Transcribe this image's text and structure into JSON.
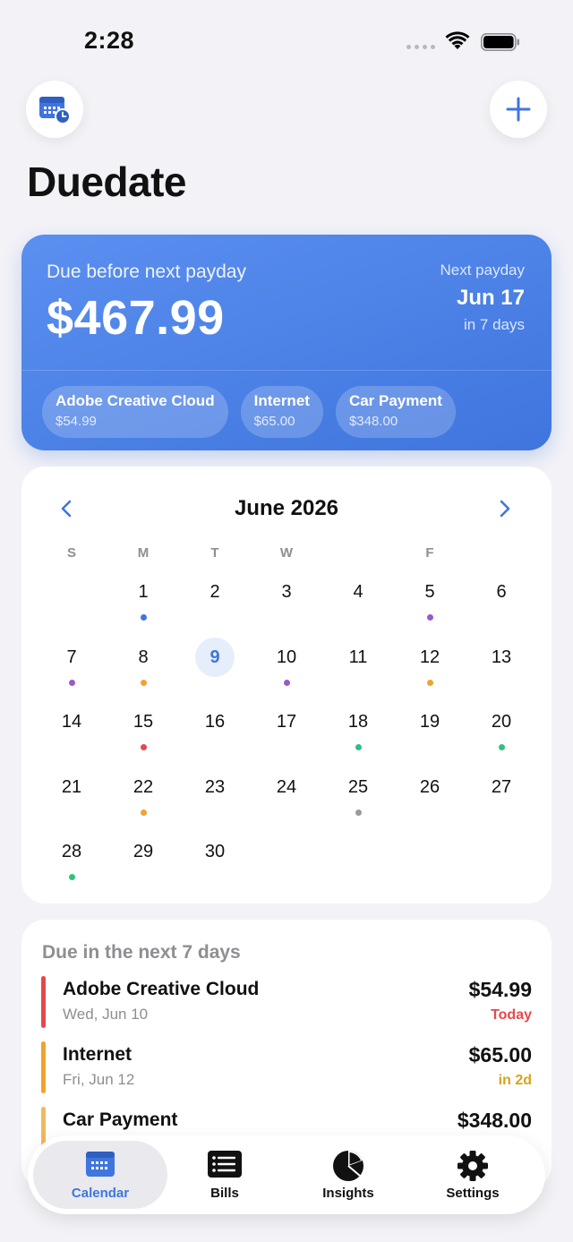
{
  "status": {
    "time": "2:28"
  },
  "header": {
    "title": "Duedate",
    "calendar_button_icon": "calendar-clock-icon",
    "add_button_icon": "plus-icon"
  },
  "colors": {
    "accent": "#3f75dd",
    "red": "#e5484d",
    "orange": "#f0a32e",
    "purple": "#9b59c6",
    "blue": "#3f75dd",
    "green": "#2ec27e",
    "gray": "#9a9a9f"
  },
  "summary": {
    "label": "Due before next payday",
    "amount": "$467.99",
    "next_payday_label": "Next payday",
    "next_payday_date": "Jun 17",
    "next_payday_in": "in 7 days",
    "chips": [
      {
        "name": "Adobe Creative Cloud",
        "amount": "$54.99"
      },
      {
        "name": "Internet",
        "amount": "$65.00"
      },
      {
        "name": "Car Payment",
        "amount": "$348.00"
      }
    ]
  },
  "calendar": {
    "month": "June 2026",
    "weekdays": [
      "S",
      "M",
      "T",
      "W",
      "",
      "F",
      ""
    ],
    "days": [
      {
        "n": "",
        "dot": null
      },
      {
        "n": "1",
        "dot": "blue"
      },
      {
        "n": "2",
        "dot": null
      },
      {
        "n": "3",
        "dot": null
      },
      {
        "n": "4",
        "dot": null
      },
      {
        "n": "5",
        "dot": "purple"
      },
      {
        "n": "6",
        "dot": null
      },
      {
        "n": "7",
        "dot": "purple"
      },
      {
        "n": "8",
        "dot": "orange"
      },
      {
        "n": "9",
        "dot": null,
        "today": true
      },
      {
        "n": "10",
        "dot": "purple"
      },
      {
        "n": "11",
        "dot": null
      },
      {
        "n": "12",
        "dot": "orange"
      },
      {
        "n": "13",
        "dot": null
      },
      {
        "n": "14",
        "dot": null
      },
      {
        "n": "15",
        "dot": "red"
      },
      {
        "n": "16",
        "dot": null
      },
      {
        "n": "17",
        "dot": null
      },
      {
        "n": "18",
        "dot": "green"
      },
      {
        "n": "19",
        "dot": null
      },
      {
        "n": "20",
        "dot": "green"
      },
      {
        "n": "21",
        "dot": null
      },
      {
        "n": "22",
        "dot": "orange"
      },
      {
        "n": "23",
        "dot": null
      },
      {
        "n": "24",
        "dot": null
      },
      {
        "n": "25",
        "dot": "gray"
      },
      {
        "n": "26",
        "dot": null
      },
      {
        "n": "27",
        "dot": null
      },
      {
        "n": "28",
        "dot": "green"
      },
      {
        "n": "29",
        "dot": null
      },
      {
        "n": "30",
        "dot": null
      }
    ]
  },
  "upcoming": {
    "heading": "Due in the next 7 days",
    "items": [
      {
        "name": "Adobe Creative Cloud",
        "date": "Wed, Jun 10",
        "amount": "$54.99",
        "status": "Today",
        "color": "red"
      },
      {
        "name": "Internet",
        "date": "Fri, Jun 12",
        "amount": "$65.00",
        "status": "in 2d",
        "color": "orange"
      },
      {
        "name": "Car Payment",
        "date": "",
        "amount": "$348.00",
        "status": "",
        "color": "orange"
      }
    ]
  },
  "tabs": [
    {
      "label": "Calendar",
      "icon": "calendar-icon",
      "active": true
    },
    {
      "label": "Bills",
      "icon": "list-icon",
      "active": false
    },
    {
      "label": "Insights",
      "icon": "pie-chart-icon",
      "active": false
    },
    {
      "label": "Settings",
      "icon": "gear-icon",
      "active": false
    }
  ]
}
